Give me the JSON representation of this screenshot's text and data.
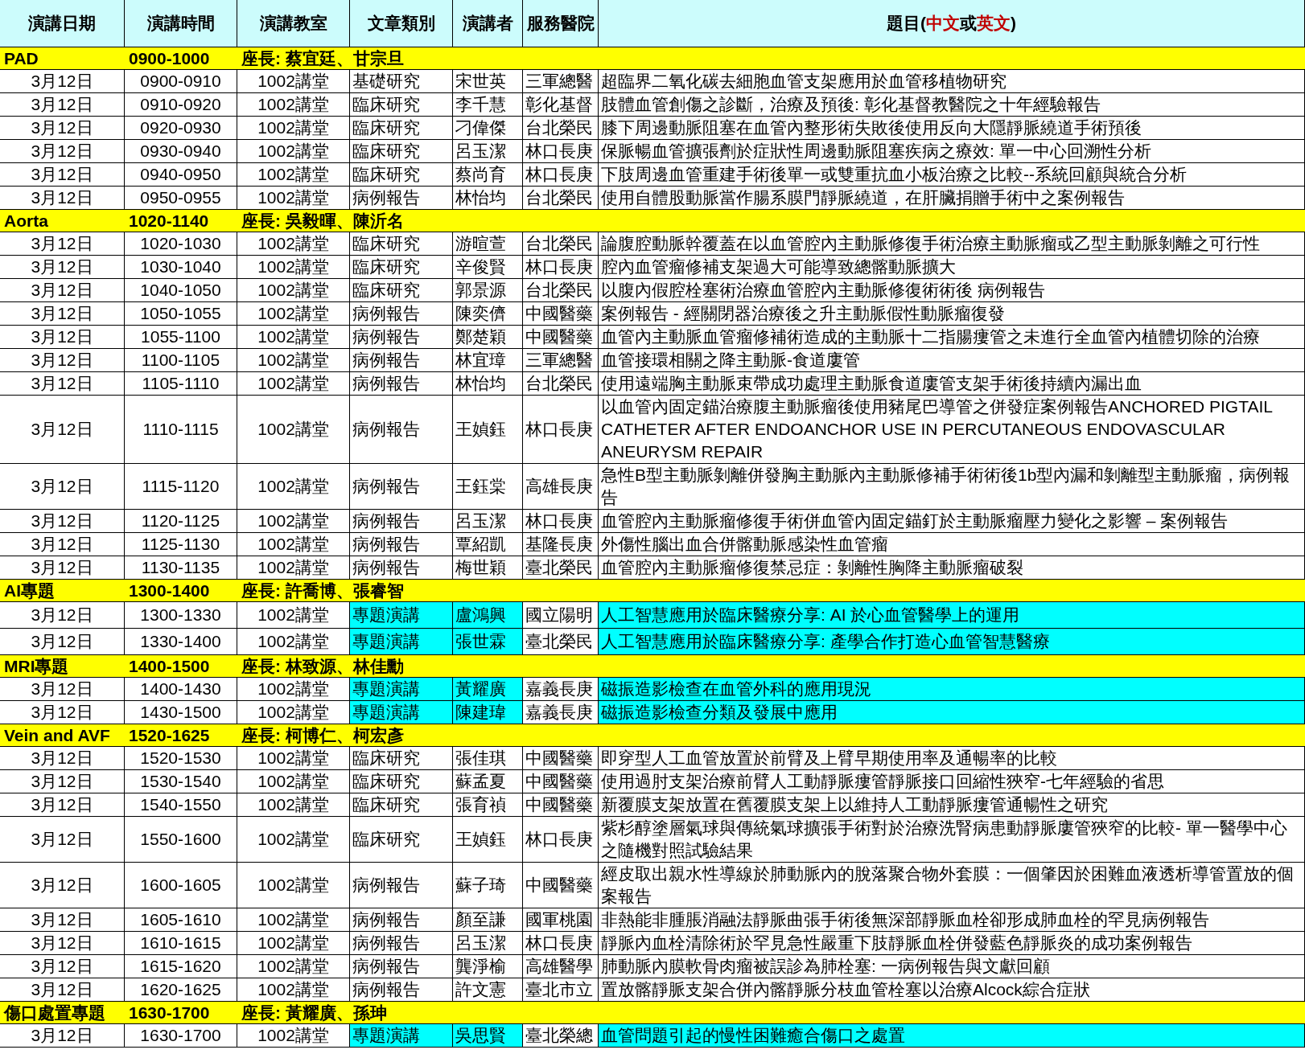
{
  "columns": [
    {
      "label": "演講日期"
    },
    {
      "label": "演講時間"
    },
    {
      "label": "演講教室"
    },
    {
      "label": "文章類別"
    },
    {
      "label": "演講者"
    },
    {
      "label": "服務醫院"
    },
    {
      "parts": [
        {
          "text": "題目(",
          "emphasis": false
        },
        {
          "text": "中文",
          "emphasis": true
        },
        {
          "text": "或",
          "emphasis": false
        },
        {
          "text": "英文",
          "emphasis": true
        },
        {
          "text": ")",
          "emphasis": false
        }
      ]
    }
  ],
  "sessions": [
    {
      "name": "PAD",
      "time": "0900-1000",
      "chair": "座長: 蔡宜廷、甘宗旦",
      "rows": [
        {
          "date": "3月12日",
          "time": "0900-0910",
          "room": "1002講堂",
          "category": "基礎研究",
          "speaker": "宋世英",
          "hospital": "三軍總醫",
          "title": "超臨界二氧化碳去細胞血管支架應用於血管移植物研究",
          "highlighted": false
        },
        {
          "date": "3月12日",
          "time": "0910-0920",
          "room": "1002講堂",
          "category": "臨床研究",
          "speaker": "李千慧",
          "hospital": "彰化基督",
          "title": "肢體血管創傷之診斷，治療及預後: 彰化基督教醫院之十年經驗報告",
          "highlighted": false
        },
        {
          "date": "3月12日",
          "time": "0920-0930",
          "room": "1002講堂",
          "category": "臨床研究",
          "speaker": "刁偉傑",
          "hospital": "台北榮民",
          "title": "膝下周邊動脈阻塞在血管內整形術失敗後使用反向大隱靜脈繞道手術預後",
          "highlighted": false
        },
        {
          "date": "3月12日",
          "time": "0930-0940",
          "room": "1002講堂",
          "category": "臨床研究",
          "speaker": "呂玉潔",
          "hospital": "林口長庚",
          "title": "保脈暢血管擴張劑於症狀性周邊動脈阻塞疾病之療效: 單一中心回溯性分析",
          "highlighted": false
        },
        {
          "date": "3月12日",
          "time": "0940-0950",
          "room": "1002講堂",
          "category": "臨床研究",
          "speaker": "蔡尚育",
          "hospital": "林口長庚",
          "title": "下肢周邊血管重建手術後單一或雙重抗血小板治療之比較--系統回顧與統合分析",
          "highlighted": false
        },
        {
          "date": "3月12日",
          "time": "0950-0955",
          "room": "1002講堂",
          "category": "病例報告",
          "speaker": "林怡均",
          "hospital": "台北榮民",
          "title": "使用自體股動脈當作腸系膜門靜脈繞道，在肝臟捐贈手術中之案例報告",
          "highlighted": false
        }
      ]
    },
    {
      "name": "Aorta",
      "time": "1020-1140",
      "chair": "座長: 吳毅暉、陳沂名",
      "rows": [
        {
          "date": "3月12日",
          "time": "1020-1030",
          "room": "1002講堂",
          "category": "臨床研究",
          "speaker": "游暄萱",
          "hospital": "台北榮民",
          "title": "論腹腔動脈幹覆蓋在以血管腔內主動脈修復手術治療主動脈瘤或乙型主動脈剝離之可行性",
          "highlighted": false
        },
        {
          "date": "3月12日",
          "time": "1030-1040",
          "room": "1002講堂",
          "category": "臨床研究",
          "speaker": "辛俊賢",
          "hospital": "林口長庚",
          "title": "腔內血管瘤修補支架過大可能導致總髂動脈擴大",
          "highlighted": false
        },
        {
          "date": "3月12日",
          "time": "1040-1050",
          "room": "1002講堂",
          "category": "臨床研究",
          "speaker": "郭景源",
          "hospital": "台北榮民",
          "title": "以腹內假腔栓塞術治療血管腔內主動脈修復術術後 病例報告",
          "highlighted": false
        },
        {
          "date": "3月12日",
          "time": "1050-1055",
          "room": "1002講堂",
          "category": "病例報告",
          "speaker": "陳奕儕",
          "hospital": "中國醫藥",
          "title": "案例報告 - 經關閉器治療後之升主動脈假性動脈瘤復發",
          "highlighted": false
        },
        {
          "date": "3月12日",
          "time": "1055-1100",
          "room": "1002講堂",
          "category": "病例報告",
          "speaker": "鄭楚穎",
          "hospital": "中國醫藥",
          "title": "血管內主動脈血管瘤修補術造成的主動脈十二指腸瘻管之未進行全血管內植體切除的治療",
          "highlighted": false
        },
        {
          "date": "3月12日",
          "time": "1100-1105",
          "room": "1002講堂",
          "category": "病例報告",
          "speaker": "林宜璋",
          "hospital": "三軍總醫",
          "title": "血管接環相關之降主動脈-食道廔管",
          "highlighted": false
        },
        {
          "date": "3月12日",
          "time": "1105-1110",
          "room": "1002講堂",
          "category": "病例報告",
          "speaker": "林怡均",
          "hospital": "台北榮民",
          "title": "使用遠端胸主動脈束帶成功處理主動脈食道廔管支架手術後持續內漏出血",
          "highlighted": false
        },
        {
          "date": "3月12日",
          "time": "1110-1115",
          "room": "1002講堂",
          "category": "病例報告",
          "speaker": "王媜鈺",
          "hospital": "林口長庚",
          "title": "以血管內固定錨治療腹主動脈瘤後使用豬尾巴導管之併發症案例報告ANCHORED PIGTAIL CATHETER AFTER ENDOANCHOR USE IN PERCUTANEOUS ENDOVASCULAR ANEURYSM REPAIR",
          "highlighted": false
        },
        {
          "date": "3月12日",
          "time": "1115-1120",
          "room": "1002講堂",
          "category": "病例報告",
          "speaker": "王鈺棠",
          "hospital": "高雄長庚",
          "title": "急性B型主動脈剝離併發胸主動脈內主動脈修補手術術後1b型內漏和剝離型主動脈瘤，病例報告",
          "highlighted": false
        },
        {
          "date": "3月12日",
          "time": "1120-1125",
          "room": "1002講堂",
          "category": "病例報告",
          "speaker": "呂玉潔",
          "hospital": "林口長庚",
          "title": "血管腔內主動脈瘤修復手術併血管內固定錨釘於主動脈瘤壓力變化之影響 – 案例報告",
          "highlighted": false
        },
        {
          "date": "3月12日",
          "time": "1125-1130",
          "room": "1002講堂",
          "category": "病例報告",
          "speaker": "覃紹凱",
          "hospital": "基隆長庚",
          "title": "外傷性腦出血合併髂動脈感染性血管瘤",
          "highlighted": false
        },
        {
          "date": "3月12日",
          "time": "1130-1135",
          "room": "1002講堂",
          "category": "病例報告",
          "speaker": "梅世穎",
          "hospital": "臺北榮民",
          "title": "血管腔內主動脈瘤修復禁忌症：剝離性胸降主動脈瘤破裂",
          "highlighted": false
        }
      ]
    },
    {
      "name": "AI專題",
      "time": "1300-1400",
      "chair": "座長: 許喬博、張睿智",
      "rows": [
        {
          "date": "3月12日",
          "time": "1300-1330",
          "room": "1002講堂",
          "category": "專題演講",
          "speaker": "盧鴻興",
          "hospital": "國立陽明",
          "title": "人工智慧應用於臨床醫療分享: AI 於心血管醫學上的運用",
          "highlighted": true
        },
        {
          "date": "3月12日",
          "time": "1330-1400",
          "room": "1002講堂",
          "category": "專題演講",
          "speaker": "張世霖",
          "hospital": "臺北榮民",
          "title": "人工智慧應用於臨床醫療分享: 產學合作打造心血管智慧醫療",
          "highlighted": true
        }
      ]
    },
    {
      "name": "MRI專題",
      "time": "1400-1500",
      "chair": "座長: 林致源、林佳勳",
      "rows": [
        {
          "date": "3月12日",
          "time": "1400-1430",
          "room": "1002講堂",
          "category": "專題演講",
          "speaker": "黃耀廣",
          "hospital": "嘉義長庚",
          "title": "磁振造影檢查在血管外科的應用現況",
          "highlighted": true
        },
        {
          "date": "3月12日",
          "time": "1430-1500",
          "room": "1002講堂",
          "category": "專題演講",
          "speaker": "陳建瑋",
          "hospital": "嘉義長庚",
          "title": "磁振造影檢查分類及發展中應用",
          "highlighted": true
        }
      ]
    },
    {
      "name": "Vein and AVF",
      "time": "1520-1625",
      "chair": "座長: 柯博仁、柯宏彥",
      "rows": [
        {
          "date": "3月12日",
          "time": "1520-1530",
          "room": "1002講堂",
          "category": "臨床研究",
          "speaker": "張佳琪",
          "hospital": "中國醫藥",
          "title": "即穿型人工血管放置於前臂及上臂早期使用率及通暢率的比較",
          "highlighted": false
        },
        {
          "date": "3月12日",
          "time": "1530-1540",
          "room": "1002講堂",
          "category": "臨床研究",
          "speaker": "蘇孟夏",
          "hospital": "中國醫藥",
          "title": "使用過肘支架治療前臂人工動靜脈瘻管靜脈接口回縮性狹窄-七年經驗的省思",
          "highlighted": false
        },
        {
          "date": "3月12日",
          "time": "1540-1550",
          "room": "1002講堂",
          "category": "臨床研究",
          "speaker": "張育禎",
          "hospital": "中國醫藥",
          "title": "新覆膜支架放置在舊覆膜支架上以維持人工動靜脈瘻管通暢性之研究",
          "highlighted": false
        },
        {
          "date": "3月12日",
          "time": "1550-1600",
          "room": "1002講堂",
          "category": "臨床研究",
          "speaker": "王媜鈺",
          "hospital": "林口長庚",
          "title": "紫杉醇塗層氣球與傳統氣球擴張手術對於治療洗腎病患動靜脈廔管狹窄的比較- 單一醫學中心之隨機對照試驗結果",
          "highlighted": false
        },
        {
          "date": "3月12日",
          "time": "1600-1605",
          "room": "1002講堂",
          "category": "病例報告",
          "speaker": "蘇子琦",
          "hospital": "中國醫藥",
          "title": "經皮取出親水性導線於肺動脈內的脫落聚合物外套膜：一個肇因於困難血液透析導管置放的個案報告",
          "highlighted": false
        },
        {
          "date": "3月12日",
          "time": "1605-1610",
          "room": "1002講堂",
          "category": "病例報告",
          "speaker": "顏至謙",
          "hospital": "國軍桃園",
          "title": "非熱能非腫脹消融法靜脈曲張手術後無深部靜脈血栓卻形成肺血栓的罕見病例報告",
          "highlighted": false
        },
        {
          "date": "3月12日",
          "time": "1610-1615",
          "room": "1002講堂",
          "category": "病例報告",
          "speaker": "呂玉潔",
          "hospital": "林口長庚",
          "title": "靜脈內血栓清除術於罕見急性嚴重下肢靜脈血栓併發藍色靜脈炎的成功案例報告",
          "highlighted": false
        },
        {
          "date": "3月12日",
          "time": "1615-1620",
          "room": "1002講堂",
          "category": "病例報告",
          "speaker": "龔淨榆",
          "hospital": "高雄醫學",
          "title": "肺動脈內膜軟骨肉瘤被誤診為肺栓塞: 一病例報告與文獻回顧",
          "highlighted": false
        },
        {
          "date": "3月12日",
          "time": "1620-1625",
          "room": "1002講堂",
          "category": "病例報告",
          "speaker": "許文憲",
          "hospital": "臺北市立",
          "title": "置放髂靜脈支架合併內髂靜脈分枝血管栓塞以治療Alcock綜合症狀",
          "highlighted": false
        }
      ]
    },
    {
      "name": "傷口處置專題",
      "time": "1630-1700",
      "chair": "座長: 黃耀廣、孫珅",
      "rows": [
        {
          "date": "3月12日",
          "time": "1630-1700",
          "room": "1002講堂",
          "category": "專題演講",
          "speaker": "吳思賢",
          "hospital": "臺北榮總",
          "title": "血管問題引起的慢性困難癒合傷口之處置",
          "highlighted": true
        }
      ]
    }
  ]
}
